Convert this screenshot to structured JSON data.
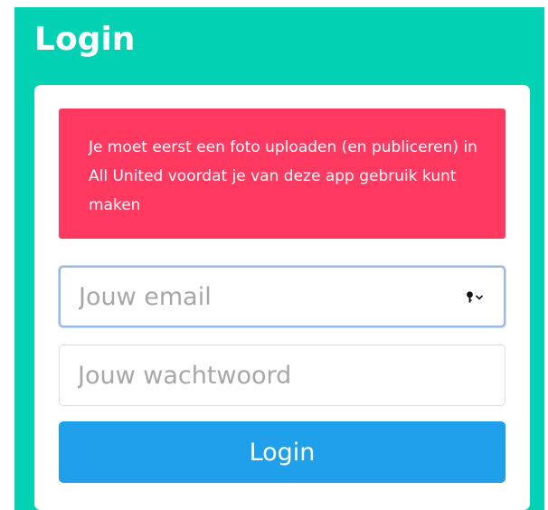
{
  "header": {
    "title": "Login"
  },
  "alert": {
    "message": "Je moet eerst een foto uploaden (en publiceren) in All United voordat je van deze app gebruik kunt maken"
  },
  "form": {
    "email_value": "",
    "email_placeholder": "Jouw email",
    "password_value": "",
    "password_placeholder": "Jouw wachtwoord",
    "submit_label": "Login",
    "password_autofill_icon": "key-icon"
  },
  "colors": {
    "background": "#03d1b4",
    "alert": "#ff3960",
    "button": "#20a0ea",
    "focus_border": "#98b8e6"
  }
}
